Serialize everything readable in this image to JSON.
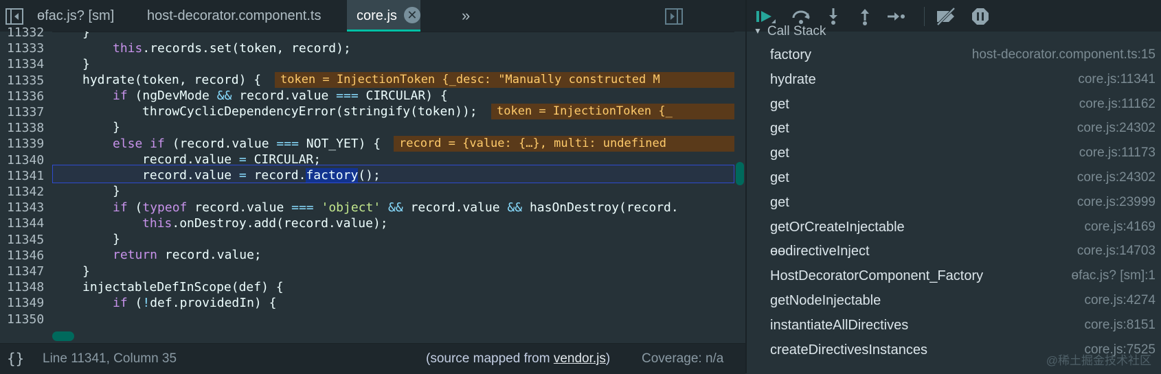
{
  "tabs": [
    {
      "label": "ɵfac.js? [sm]",
      "active": false
    },
    {
      "label": "host-decorator.component.ts",
      "active": false
    },
    {
      "label": "core.js",
      "active": true
    }
  ],
  "tab_close_glyph": "✕",
  "tab_more_glyph": "»",
  "editor": {
    "line_numbers": [
      "11332",
      "11333",
      "11334",
      "11335",
      "11336",
      "11337",
      "11338",
      "11339",
      "11340",
      "11341",
      "11342",
      "11343",
      "11344",
      "11345",
      "11346",
      "11347",
      "11348",
      "11349",
      "11350"
    ],
    "current_line": "11341",
    "selected_word": "factory",
    "inline_values": [
      "token = InjectionToken {_desc: \"Manually constructed M",
      "token = InjectionToken {_",
      "record = {value: {…}, multi: undefined"
    ]
  },
  "status": {
    "position": "Line 11341, Column 35",
    "source_prefix": "(source mapped from ",
    "source_link": "vendor.js",
    "source_suffix": ")",
    "coverage": "Coverage: n/a",
    "braces_icon": "{}"
  },
  "call_stack": {
    "header": "Call Stack",
    "frames": [
      {
        "fn": "factory",
        "loc": "host-decorator.component.ts:15"
      },
      {
        "fn": "hydrate",
        "loc": "core.js:11341"
      },
      {
        "fn": "get",
        "loc": "core.js:11162"
      },
      {
        "fn": "get",
        "loc": "core.js:24302"
      },
      {
        "fn": "get",
        "loc": "core.js:11173"
      },
      {
        "fn": "get",
        "loc": "core.js:24302"
      },
      {
        "fn": "get",
        "loc": "core.js:23999"
      },
      {
        "fn": "getOrCreateInjectable",
        "loc": "core.js:4169"
      },
      {
        "fn": "ɵɵdirectiveInject",
        "loc": "core.js:14703"
      },
      {
        "fn": "HostDecoratorComponent_Factory",
        "loc": "ɵfac.js? [sm]:1"
      },
      {
        "fn": "getNodeInjectable",
        "loc": "core.js:4274"
      },
      {
        "fn": "instantiateAllDirectives",
        "loc": "core.js:8151"
      },
      {
        "fn": "createDirectivesInstances",
        "loc": "core.js:7525"
      }
    ]
  },
  "watermark": "@稀土掘金技术社区",
  "colors": {
    "accent": "#00bfa5",
    "keyword": "#c792ea",
    "string": "#c3e88d",
    "operator": "#89ddff"
  }
}
